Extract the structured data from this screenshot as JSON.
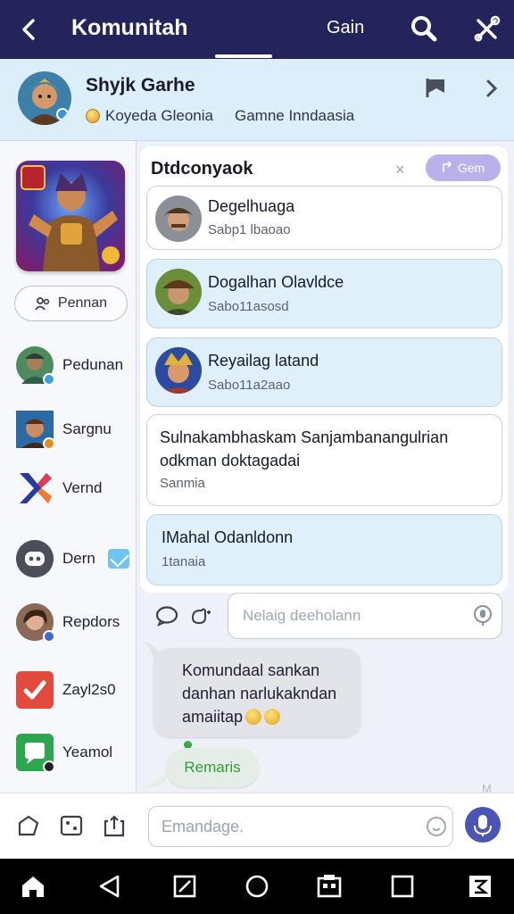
{
  "topbar": {
    "title": "Komunitah",
    "tab_label": "Gain",
    "icons": [
      "back-arrow-icon",
      "search-icon",
      "tools-icon"
    ]
  },
  "game": {
    "name": "Shyjk Garhe",
    "meta": "Koyeda Gleonia",
    "region": "Gamne Inndaasia"
  },
  "sidebar": {
    "follow_label": "Pennan",
    "items": [
      {
        "label": "Pedunan"
      },
      {
        "label": "Sargnu"
      },
      {
        "label": "Vernd"
      },
      {
        "label": "Dern"
      },
      {
        "label": "Repdors"
      },
      {
        "label": "Zayl2s0"
      },
      {
        "label": "Yeamol"
      }
    ]
  },
  "panel": {
    "title": "Dtdconyaok",
    "close_label": "×",
    "chip_label": "Gem"
  },
  "cards": [
    {
      "name": "Degelhuaga",
      "sub": "Sabp1 lbaoao"
    },
    {
      "name": "Dogalhan Olavldce",
      "sub": "Sabo11asosd"
    },
    {
      "name": "Reyailag latand",
      "sub": "Sabo11a2aao"
    },
    {
      "line1": "Sulnakambhaskam Sanjambanangulrian",
      "line2": "odkman doktagadai",
      "sub": "Sanmia"
    },
    {
      "name": "IMahal Odanldonn",
      "sub": "1tanaia"
    }
  ],
  "reply": {
    "placeholder": "Nelaig deeholann"
  },
  "bubble": {
    "line1": "Komundaal sankan",
    "line2": "danhan narlukakndan",
    "line3": "amaiitap"
  },
  "remaris_label": "Remaris",
  "watermark": "M",
  "composer": {
    "placeholder": "Emandage."
  },
  "colors": {
    "topbar": "#23245c",
    "accent_chip": "#b8b1ea",
    "card_blue": "#dff0fb",
    "mic_button": "#4b55b6",
    "remaris_text": "#2f9a3a"
  }
}
